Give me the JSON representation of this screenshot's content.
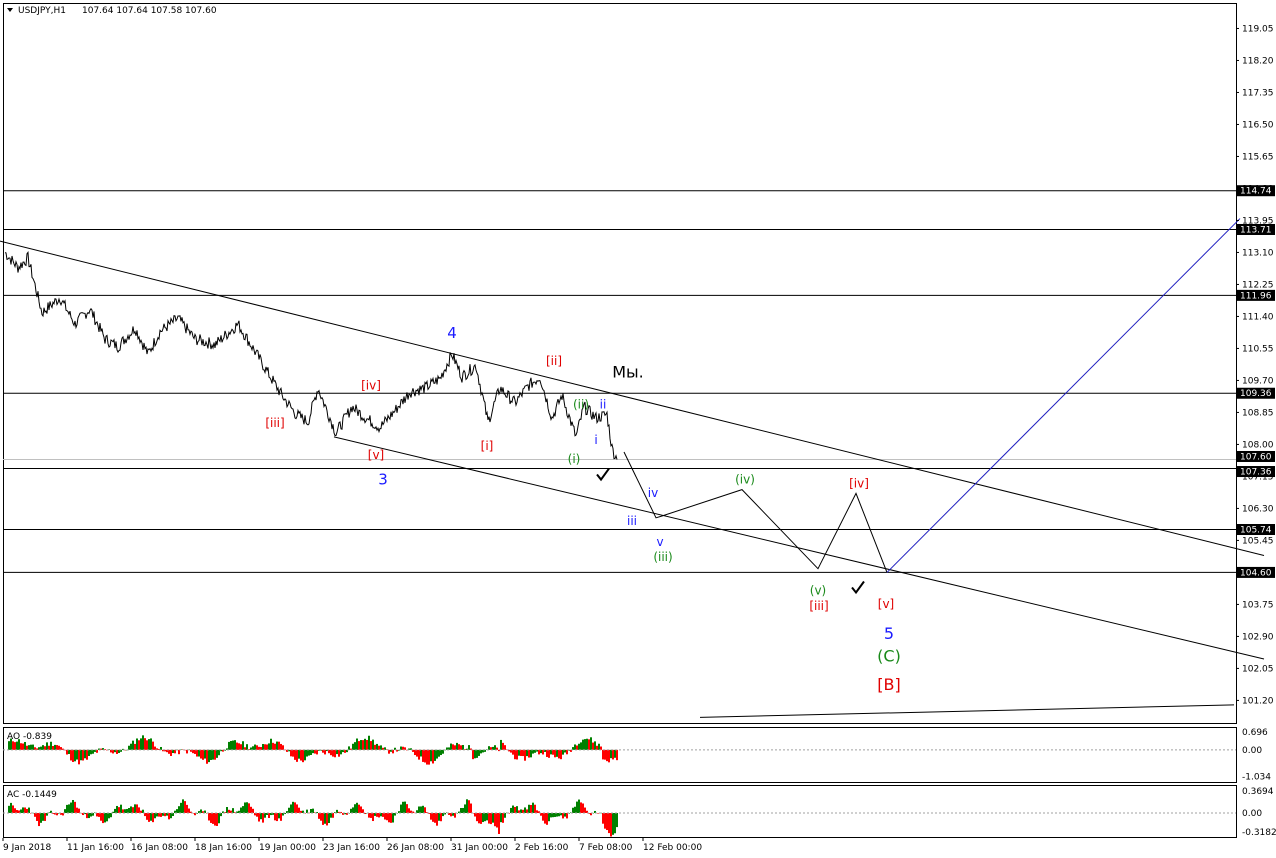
{
  "header": {
    "symbol": "USDJPY,H1",
    "ohlc": "107.64 107.64 107.58 107.60"
  },
  "colors": {
    "background": "#ffffff",
    "price": "#000000",
    "label_blue": "#1a1aff",
    "label_red": "#e00000",
    "label_green": "#1a8a1a",
    "projection_blue": "#2020c0",
    "osc_green": "#008000",
    "osc_red": "#ff0000"
  },
  "chart_data": [
    {
      "type": "line",
      "title": "USDJPY,H1",
      "ylim": [
        100.6,
        119.7
      ],
      "yticks": [
        119.05,
        118.2,
        117.35,
        116.5,
        115.65,
        114.8,
        113.95,
        113.1,
        112.25,
        111.4,
        110.55,
        109.7,
        108.85,
        108.0,
        107.15,
        106.3,
        105.45,
        104.6,
        103.75,
        102.9,
        102.05,
        101.2
      ],
      "xticks": [
        "9 Jan 2018",
        "11 Jan 16:00",
        "16 Jan 08:00",
        "18 Jan 16:00",
        "19 Jan 00:00",
        "23 Jan 16:00",
        "26 Jan 08:00",
        "31 Jan 00:00",
        "2 Feb 16:00",
        "7 Feb 08:00",
        "12 Feb 00:00"
      ],
      "current_price": "107.60",
      "horizontal_levels": [
        {
          "value": 114.74,
          "label": "114.74"
        },
        {
          "value": 113.71,
          "label": "113.71"
        },
        {
          "value": 111.96,
          "label": "111.96"
        },
        {
          "value": 109.36,
          "label": "109.36"
        },
        {
          "value": 107.36,
          "label": "107.36"
        },
        {
          "value": 105.74,
          "label": "105.74"
        },
        {
          "value": 104.6,
          "label": "104.60"
        }
      ],
      "price_anchors": [
        {
          "x": 5,
          "y": 113.1
        },
        {
          "x": 18,
          "y": 112.7
        },
        {
          "x": 28,
          "y": 112.95
        },
        {
          "x": 42,
          "y": 111.5
        },
        {
          "x": 60,
          "y": 111.9
        },
        {
          "x": 75,
          "y": 111.2
        },
        {
          "x": 90,
          "y": 111.6
        },
        {
          "x": 105,
          "y": 110.8
        },
        {
          "x": 118,
          "y": 110.6
        },
        {
          "x": 135,
          "y": 111.1
        },
        {
          "x": 148,
          "y": 110.4
        },
        {
          "x": 160,
          "y": 111.0
        },
        {
          "x": 178,
          "y": 111.35
        },
        {
          "x": 195,
          "y": 110.8
        },
        {
          "x": 215,
          "y": 110.65
        },
        {
          "x": 238,
          "y": 111.2
        },
        {
          "x": 252,
          "y": 110.6
        },
        {
          "x": 268,
          "y": 109.9
        },
        {
          "x": 282,
          "y": 109.3
        },
        {
          "x": 296,
          "y": 108.8
        },
        {
          "x": 308,
          "y": 108.6
        },
        {
          "x": 318,
          "y": 109.5
        },
        {
          "x": 330,
          "y": 108.7
        },
        {
          "x": 336,
          "y": 108.3
        },
        {
          "x": 352,
          "y": 109.0
        },
        {
          "x": 366,
          "y": 108.7
        },
        {
          "x": 380,
          "y": 108.45
        },
        {
          "x": 395,
          "y": 108.9
        },
        {
          "x": 410,
          "y": 109.4
        },
        {
          "x": 425,
          "y": 109.5
        },
        {
          "x": 440,
          "y": 109.75
        },
        {
          "x": 452,
          "y": 110.4
        },
        {
          "x": 462,
          "y": 109.8
        },
        {
          "x": 476,
          "y": 110.1
        },
        {
          "x": 488,
          "y": 108.6
        },
        {
          "x": 500,
          "y": 109.5
        },
        {
          "x": 515,
          "y": 109.1
        },
        {
          "x": 528,
          "y": 109.55
        },
        {
          "x": 540,
          "y": 109.8
        },
        {
          "x": 552,
          "y": 108.7
        },
        {
          "x": 562,
          "y": 109.3
        },
        {
          "x": 576,
          "y": 108.2
        },
        {
          "x": 584,
          "y": 109.0
        },
        {
          "x": 596,
          "y": 108.7
        },
        {
          "x": 607,
          "y": 108.8
        },
        {
          "x": 612,
          "y": 107.9
        },
        {
          "x": 617,
          "y": 107.6
        }
      ],
      "projection_path": [
        {
          "x": 624,
          "y": 107.8
        },
        {
          "x": 656,
          "y": 106.05
        },
        {
          "x": 662,
          "y": 106.1
        },
        {
          "x": 742,
          "y": 106.8
        },
        {
          "x": 818,
          "y": 104.7
        },
        {
          "x": 856,
          "y": 106.7
        },
        {
          "x": 887,
          "y": 104.6
        }
      ],
      "projection_up": [
        {
          "x": 887,
          "y": 104.6
        },
        {
          "x": 1240,
          "y": 114.0
        }
      ],
      "channel_lines": [
        {
          "from": {
            "x": 0,
            "y": 113.4
          },
          "to": {
            "x": 1264,
            "y": 105.05
          }
        },
        {
          "from": {
            "x": 334,
            "y": 108.2
          },
          "to": {
            "x": 1264,
            "y": 102.3
          }
        },
        {
          "from": {
            "x": 700,
            "y": 100.75
          },
          "to": {
            "x": 1234,
            "y": 101.08
          }
        }
      ],
      "wave_labels": [
        {
          "text": "4",
          "x": 452,
          "y": 110.95,
          "color": "label_blue",
          "size": 15
        },
        {
          "text": "3",
          "x": 383,
          "y": 107.05,
          "color": "label_blue",
          "size": 15
        },
        {
          "text": "[iv]",
          "x": 371,
          "y": 109.55,
          "color": "label_red",
          "size": 12
        },
        {
          "text": "[iii]",
          "x": 275,
          "y": 108.55,
          "color": "label_red",
          "size": 12
        },
        {
          "text": "[v]",
          "x": 376,
          "y": 107.7,
          "color": "label_red",
          "size": 12
        },
        {
          "text": "[ii]",
          "x": 554,
          "y": 110.2,
          "color": "label_red",
          "size": 12
        },
        {
          "text": "[i]",
          "x": 487,
          "y": 107.95,
          "color": "label_red",
          "size": 12
        },
        {
          "text": "(ii)",
          "x": 581,
          "y": 109.05,
          "color": "label_green",
          "size": 12
        },
        {
          "text": "ii",
          "x": 603,
          "y": 109.05,
          "color": "label_blue",
          "size": 12
        },
        {
          "text": "i",
          "x": 596,
          "y": 108.1,
          "color": "label_blue",
          "size": 12
        },
        {
          "text": "(i)",
          "x": 574,
          "y": 107.6,
          "color": "label_green",
          "size": 12
        },
        {
          "text": "Мы.",
          "x": 628,
          "y": 109.9,
          "color": "price",
          "size": 16
        },
        {
          "text": "iv",
          "x": 653,
          "y": 106.7,
          "color": "label_blue",
          "size": 12
        },
        {
          "text": "iii",
          "x": 632,
          "y": 105.95,
          "color": "label_blue",
          "size": 12
        },
        {
          "text": "v",
          "x": 660,
          "y": 105.4,
          "color": "label_blue",
          "size": 12
        },
        {
          "text": "(iii)",
          "x": 663,
          "y": 105.0,
          "color": "label_green",
          "size": 12
        },
        {
          "text": "(iv)",
          "x": 745,
          "y": 107.05,
          "color": "label_green",
          "size": 12
        },
        {
          "text": "[iv]",
          "x": 859,
          "y": 106.95,
          "color": "label_red",
          "size": 12
        },
        {
          "text": "(v)",
          "x": 818,
          "y": 104.1,
          "color": "label_green",
          "size": 12
        },
        {
          "text": "[iii]",
          "x": 819,
          "y": 103.7,
          "color": "label_red",
          "size": 12
        },
        {
          "text": "[v]",
          "x": 886,
          "y": 103.75,
          "color": "label_red",
          "size": 12
        },
        {
          "text": "5",
          "x": 889,
          "y": 102.95,
          "color": "label_blue",
          "size": 16
        },
        {
          "text": "(C)",
          "x": 889,
          "y": 102.35,
          "color": "label_green",
          "size": 16
        },
        {
          "text": "[B]",
          "x": 889,
          "y": 101.6,
          "color": "label_red",
          "size": 16
        }
      ],
      "checkmarks": [
        {
          "x": 603,
          "y": 107.2
        },
        {
          "x": 858,
          "y": 104.2
        }
      ]
    },
    {
      "type": "bar",
      "title": "AO -0.839",
      "ylim": [
        -1.25,
        0.85
      ],
      "yticks": [
        0.696,
        0.0,
        -1.034
      ],
      "ytick_labels": [
        "0.696",
        "0.00",
        "-1.034"
      ]
    },
    {
      "type": "bar",
      "title": "AC -0.1449",
      "ylim": [
        -0.4,
        0.45
      ],
      "yticks": [
        0.3694,
        0.0,
        -0.3182
      ],
      "ytick_labels": [
        "0.3694",
        "0.00",
        "-0.3182"
      ]
    }
  ]
}
